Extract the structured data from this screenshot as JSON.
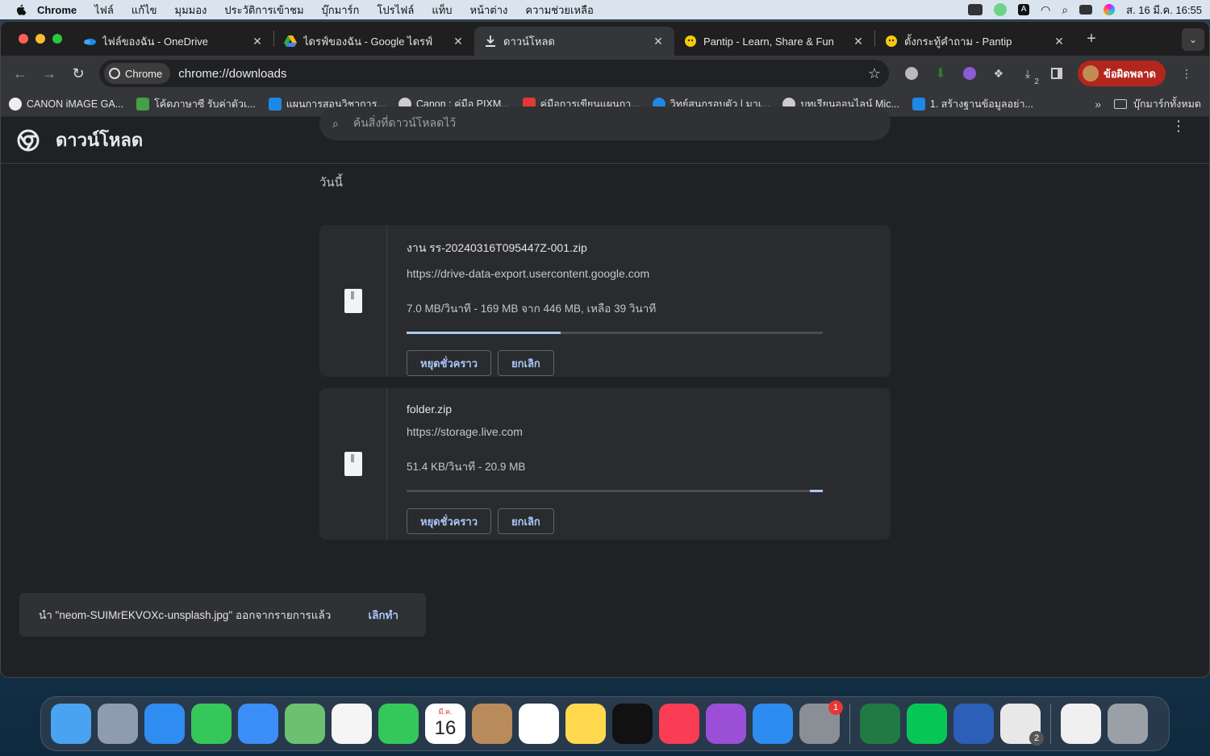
{
  "menubar": {
    "items": [
      "Chrome",
      "ไฟล์",
      "แก้ไข",
      "มุมมอง",
      "ประวัติการเข้าชม",
      "บุ๊กมาร์ก",
      "โปรไฟล์",
      "แท็บ",
      "หน้าต่าง",
      "ความช่วยเหลือ"
    ],
    "datetime": "ส. 16 มี.ค.  16:55",
    "input_source": "A"
  },
  "tabs": [
    {
      "title": "ไฟล์ของฉัน - OneDrive",
      "icon": "onedrive-icon",
      "color": "#1e88e5"
    },
    {
      "title": "ไดรฟ์ของฉัน - Google ไดรฟ์",
      "icon": "google-drive-icon",
      "color": "#34a853"
    },
    {
      "title": "ดาวน์โหลด",
      "icon": "download-icon",
      "color": "#e3e3e3",
      "active": true
    },
    {
      "title": "Pantip - Learn, Share & Fun",
      "icon": "pantip-icon",
      "color": "#f6c90e"
    },
    {
      "title": "ตั้งกระทู้คำถาม - Pantip",
      "icon": "pantip-icon",
      "color": "#f6c90e"
    }
  ],
  "omnibox": {
    "chip": "Chrome",
    "url": "chrome://downloads"
  },
  "toolbar": {
    "download_count": "2",
    "error_label": "ข้อผิดพลาด"
  },
  "bookmarks": [
    {
      "label": "CANON iMAGE GA...",
      "color": "#eeeeee"
    },
    {
      "label": "โค้ดภาษาซี รับค่าตัวเ...",
      "color": "#43a047"
    },
    {
      "label": "แผนการสอนวิชาการ...",
      "color": "#1e88e5"
    },
    {
      "label": "Canon : คู่มือ PIXM...",
      "color": "#cccccc"
    },
    {
      "label": "คู่มือการเขียนแผนกา...",
      "color": "#e53935"
    },
    {
      "label": "วิทย์สนุกรอบตัว | มาเ...",
      "color": "#1e88e5"
    },
    {
      "label": "บทเรียนออนไลน์ Mic...",
      "color": "#cccccc"
    },
    {
      "label": "1. สร้างฐานข้อมูลอย่า...",
      "color": "#1e88e5"
    }
  ],
  "bookmarks_more": "»",
  "bookmarks_all": "บุ๊กมาร์กทั้งหมด",
  "downloads": {
    "title": "ดาวน์โหลด",
    "search_placeholder": "ค้นสิ่งที่ดาวน์โหลดไว้",
    "section": "วันนี้",
    "items": [
      {
        "name": "งาน รร-20240316T095447Z-001.zip",
        "url": "https://drive-data-export.usercontent.google.com",
        "status": "7.0 MB/วินาที - 169 MB จาก 446 MB, เหลือ 39 วินาที",
        "progress": 0.37,
        "pause": "หยุดชั่วคราว",
        "cancel": "ยกเลิก"
      },
      {
        "name": "folder.zip",
        "url": "https://storage.live.com",
        "status": "51.4 KB/วินาที - 20.9 MB",
        "progress_indeterminate": true,
        "pause": "หยุดชั่วคราว",
        "cancel": "ยกเลิก"
      }
    ]
  },
  "toast": {
    "message": "นำ \"neom-SUIMrEKVOXc-unsplash.jpg\" ออกจากรายการแล้ว",
    "undo": "เลิกทำ"
  },
  "dock": {
    "apps": [
      {
        "name": "finder",
        "color": "#4aa3f0"
      },
      {
        "name": "launchpad",
        "color": "#8e9bb0"
      },
      {
        "name": "safari",
        "color": "#2f8cf0"
      },
      {
        "name": "messages",
        "color": "#35c759"
      },
      {
        "name": "mail",
        "color": "#3b8ef5"
      },
      {
        "name": "maps",
        "color": "#6cc070"
      },
      {
        "name": "photos",
        "color": "#f5f5f5"
      },
      {
        "name": "facetime",
        "color": "#34c759"
      },
      {
        "name": "calendar",
        "color": "#ffffff"
      },
      {
        "name": "contacts",
        "color": "#b98a5a"
      },
      {
        "name": "reminders",
        "color": "#ffffff"
      },
      {
        "name": "notes",
        "color": "#ffd84d"
      },
      {
        "name": "tv",
        "color": "#111111"
      },
      {
        "name": "music",
        "color": "#fa3c55"
      },
      {
        "name": "podcasts",
        "color": "#9b4fd6"
      },
      {
        "name": "app-store",
        "color": "#2d8cf0"
      },
      {
        "name": "system-settings",
        "color": "#8a8f96"
      },
      {
        "name": "excel",
        "color": "#1f7a44"
      },
      {
        "name": "line",
        "color": "#06c755"
      },
      {
        "name": "word",
        "color": "#2b5fb8"
      },
      {
        "name": "chrome",
        "color": "#e8e8e8"
      },
      {
        "name": "document",
        "color": "#f0f0f0"
      },
      {
        "name": "trash",
        "color": "#9aa0a6"
      }
    ],
    "calendar_month": "มี.ค.",
    "calendar_day": "16",
    "settings_badge": "1",
    "chrome_badge": "2"
  }
}
